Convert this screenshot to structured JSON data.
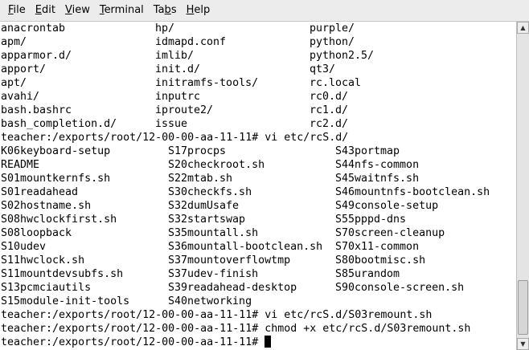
{
  "menu": {
    "file": {
      "mnemonic": "F",
      "rest": "ile"
    },
    "edit": {
      "mnemonic": "E",
      "rest": "dit"
    },
    "view": {
      "mnemonic": "V",
      "rest": "iew"
    },
    "terminal": {
      "pre": "",
      "mnemonic": "T",
      "rest": "erminal"
    },
    "tabs": {
      "pre": "Ta",
      "mnemonic": "b",
      "rest": "s"
    },
    "help": {
      "mnemonic": "H",
      "rest": "elp"
    }
  },
  "terminal": {
    "listing_etc": [
      [
        "anacrontab",
        "hp/",
        "purple/"
      ],
      [
        "apm/",
        "idmapd.conf",
        "python/"
      ],
      [
        "apparmor.d/",
        "imlib/",
        "python2.5/"
      ],
      [
        "apport/",
        "init.d/",
        "qt3/"
      ],
      [
        "apt/",
        "initramfs-tools/",
        "rc.local"
      ],
      [
        "avahi/",
        "inputrc",
        "rc0.d/"
      ],
      [
        "bash.bashrc",
        "iproute2/",
        "rc1.d/"
      ],
      [
        "bash_completion.d/",
        "issue",
        "rc2.d/"
      ]
    ],
    "cmd1": "teacher:/exports/root/12-00-00-aa-11-11# vi etc/rcS.d/",
    "listing_rcs": [
      [
        "K06keyboard-setup",
        "S17procps",
        "S43portmap"
      ],
      [
        "README",
        "S20checkroot.sh",
        "S44nfs-common"
      ],
      [
        "S01mountkernfs.sh",
        "S22mtab.sh",
        "S45waitnfs.sh"
      ],
      [
        "S01readahead",
        "S30checkfs.sh",
        "S46mountnfs-bootclean.sh"
      ],
      [
        "S02hostname.sh",
        "S32dumUsafe",
        "S49console-setup"
      ],
      [
        "S08hwclockfirst.sh",
        "S32startswap",
        "S55pppd-dns"
      ],
      [
        "S08loopback",
        "S35mountall.sh",
        "S70screen-cleanup"
      ],
      [
        "S10udev",
        "S36mountall-bootclean.sh",
        "S70x11-common"
      ],
      [
        "S11hwclock.sh",
        "S37mountoverflowtmp",
        "S80bootmisc.sh"
      ],
      [
        "S11mountdevsubfs.sh",
        "S37udev-finish",
        "S85urandom"
      ],
      [
        "S13pcmciautils",
        "S39readahead-desktop",
        "S90console-screen.sh"
      ],
      [
        "S15module-init-tools",
        "S40networking",
        ""
      ]
    ],
    "cmd2": "teacher:/exports/root/12-00-00-aa-11-11# vi etc/rcS.d/S03remount.sh",
    "cmd3": "teacher:/exports/root/12-00-00-aa-11-11# chmod +x etc/rcS.d/S03remount.sh",
    "prompt": "teacher:/exports/root/12-00-00-aa-11-11# "
  },
  "scrollbar": {
    "up_icon": "arrow-up-icon",
    "down_icon": "arrow-down-icon"
  }
}
